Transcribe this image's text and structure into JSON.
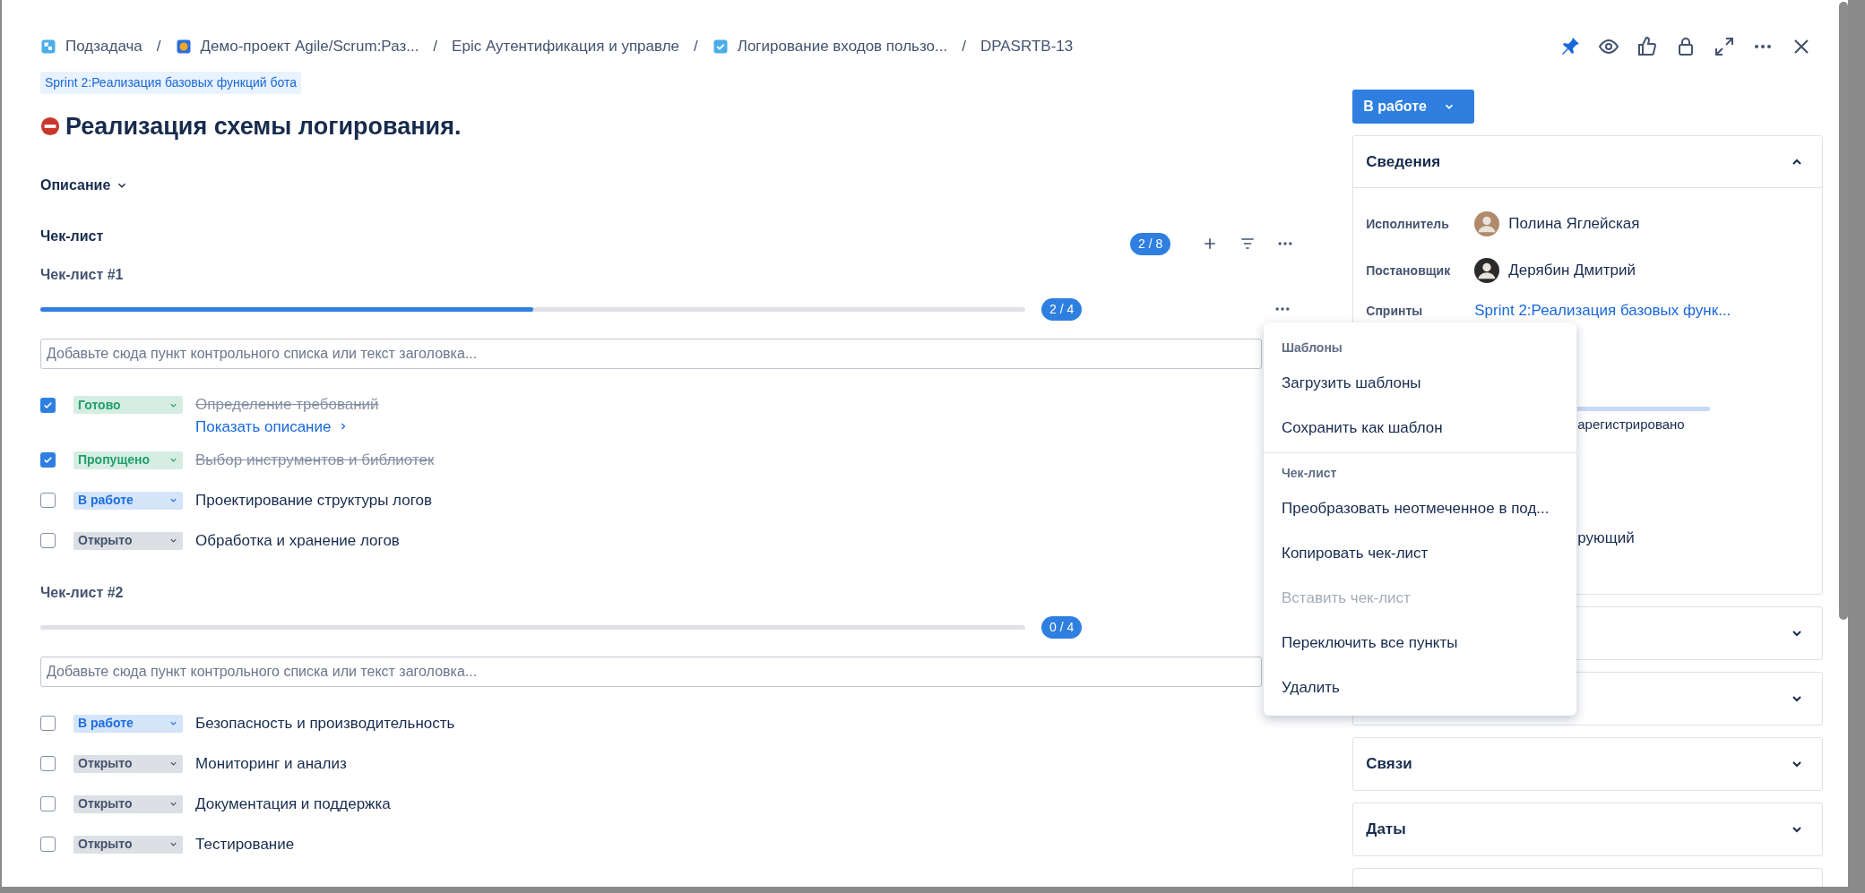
{
  "breadcrumbs": [
    {
      "kind": "subtask",
      "label": "Подзадача"
    },
    {
      "kind": "project",
      "label": "Демо-проект Agile/Scrum:Раз...",
      "separator": "/"
    },
    {
      "kind": "epic",
      "label": "Epic Аутентификация и управле",
      "separator": "/"
    },
    {
      "kind": "task",
      "label": "Логирование входов пользо...",
      "separator": "/"
    },
    {
      "kind": "key",
      "label": "DPASRTB-13",
      "separator": "/"
    }
  ],
  "sprint_tag": "Sprint 2:Реализация базовых функций бота",
  "title": "Реализация схемы логирования.",
  "description_toggle": "Описание",
  "checklist": {
    "title": "Чек-лист",
    "total": "2 / 8",
    "lists": [
      {
        "title": "Чек-лист #1",
        "level": 0.5,
        "count": "2 / 4",
        "placeholder": "Добавьте сюда пункт контрольного списка или текст заголовка...",
        "items": [
          {
            "checked": true,
            "status": "Готово",
            "color": "#22a06b",
            "text": "Определение требований",
            "description_link": "Показать описание"
          },
          {
            "checked": true,
            "status": "Пропущено",
            "color": "#22a06b",
            "text": "Выбор инструментов и библиотек"
          },
          {
            "checked": false,
            "status": "В работе",
            "color": "#1d6ee0",
            "text": "Проектирование структуры логов"
          },
          {
            "checked": false,
            "status": "Открыто",
            "color": "#44546f",
            "text": "Обработка и хранение логов"
          }
        ]
      },
      {
        "title": "Чек-лист #2",
        "level": 0,
        "count": "0 / 4",
        "placeholder": "Добавьте сюда пункт контрольного списка или текст заголовка...",
        "items": [
          {
            "checked": false,
            "status": "В работе",
            "color": "#1d6ee0",
            "text": "Безопасность и производительность"
          },
          {
            "checked": false,
            "status": "Открыто",
            "color": "#44546f",
            "text": "Мониторинг и анализ"
          },
          {
            "checked": false,
            "status": "Открыто",
            "color": "#44546f",
            "text": "Документация и поддержка"
          },
          {
            "checked": false,
            "status": "Открыто",
            "color": "#44546f",
            "text": "Тестирование"
          }
        ]
      }
    ]
  },
  "status_button": "В работе",
  "details": {
    "title": "Сведения",
    "expanded": true,
    "fields": [
      {
        "label": "Исполнитель",
        "kind": "person",
        "value": "Полина Яглейская"
      },
      {
        "label": "Постановщик",
        "kind": "person",
        "value": "Дерябин Дмитрий"
      },
      {
        "label": "Спринты",
        "kind": "link",
        "value": "Sprint 2:Реализация базовых функ..."
      }
    ],
    "partial_values": [
      {
        "kind": "progress"
      },
      {
        "kind": "text",
        "value": "арегистрировано"
      },
      {
        "kind": "text",
        "value": "рующий"
      }
    ]
  },
  "panels": [
    {
      "expanded": false
    },
    {
      "expanded": false
    },
    {
      "title": "Связи",
      "expanded": false
    },
    {
      "title": "Даты",
      "expanded": false
    }
  ],
  "menu": {
    "sections": [
      {
        "title": "Шаблоны",
        "items": [
          {
            "label": "Загрузить шаблоны",
            "disabled": false
          },
          {
            "label": "Сохранить как шаблон",
            "disabled": false
          }
        ]
      },
      {
        "title": "Чек-лист",
        "items": [
          {
            "label": "Преобразовать неотмеченное в под...",
            "disabled": false
          },
          {
            "label": "Копировать чек-лист",
            "disabled": false
          },
          {
            "label": "Вставить чек-лист",
            "disabled": true
          },
          {
            "label": "Переключить все пункты",
            "disabled": false
          },
          {
            "label": "Удалить",
            "disabled": false
          }
        ]
      }
    ]
  }
}
